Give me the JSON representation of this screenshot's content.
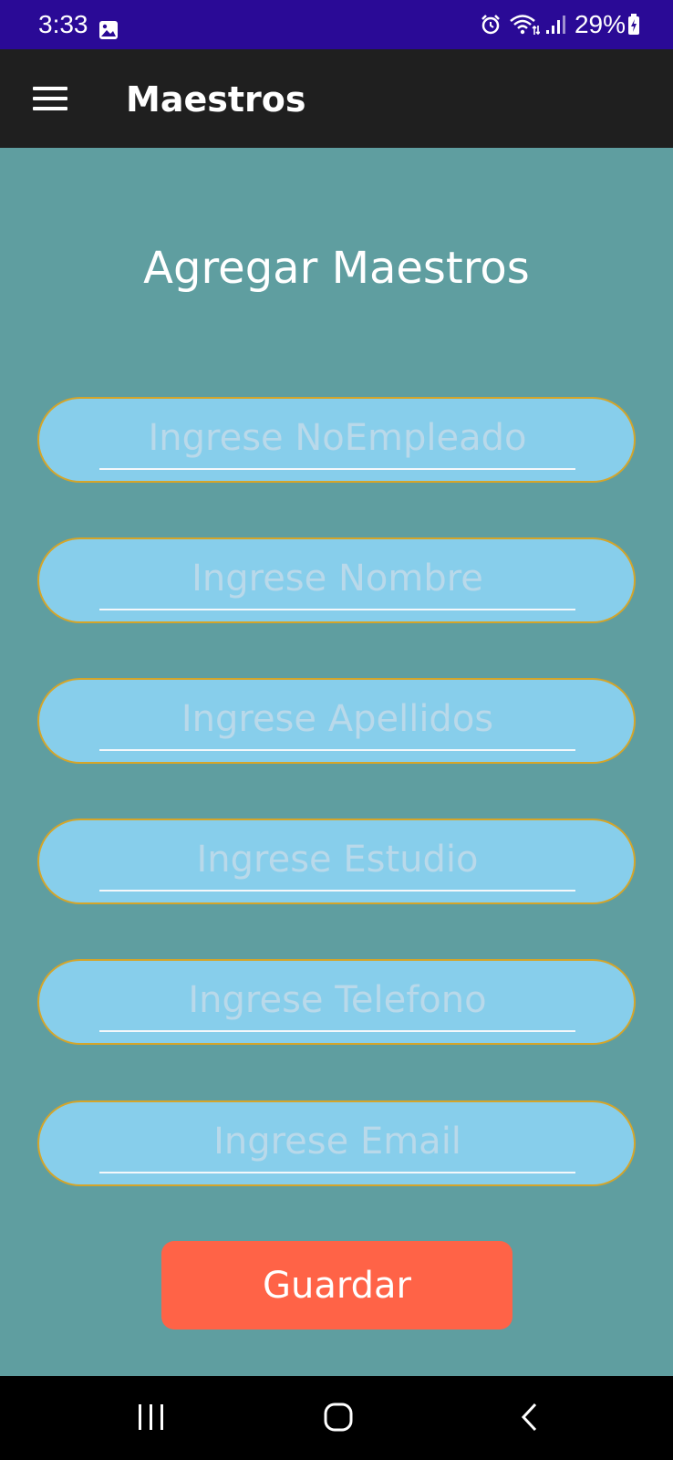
{
  "status_bar": {
    "time": "3:33",
    "battery": "29%",
    "background": "#2a0a96",
    "icons": [
      "gallery-icon",
      "alarm-icon",
      "wifi-icon",
      "signal-icon",
      "battery-charging-icon"
    ]
  },
  "app_bar": {
    "title": "Maestros",
    "menu_icon": "hamburger-menu-icon",
    "background": "#1f1f1f"
  },
  "form": {
    "heading": "Agregar Maestros",
    "fields": [
      {
        "placeholder": "Ingrese NoEmpleado",
        "value": ""
      },
      {
        "placeholder": "Ingrese Nombre",
        "value": ""
      },
      {
        "placeholder": "Ingrese Apellidos",
        "value": ""
      },
      {
        "placeholder": "Ingrese Estudio",
        "value": ""
      },
      {
        "placeholder": "Ingrese Telefono",
        "value": ""
      },
      {
        "placeholder": "Ingrese Email",
        "value": ""
      }
    ],
    "save_label": "Guardar"
  },
  "colors": {
    "page_background": "#5f9ea0",
    "field_fill": "#87ceeb",
    "field_border": "#d4a52a",
    "save_button": "#ff6347"
  },
  "nav_bar": {
    "buttons": [
      "recent-apps-icon",
      "home-icon",
      "back-icon"
    ]
  }
}
